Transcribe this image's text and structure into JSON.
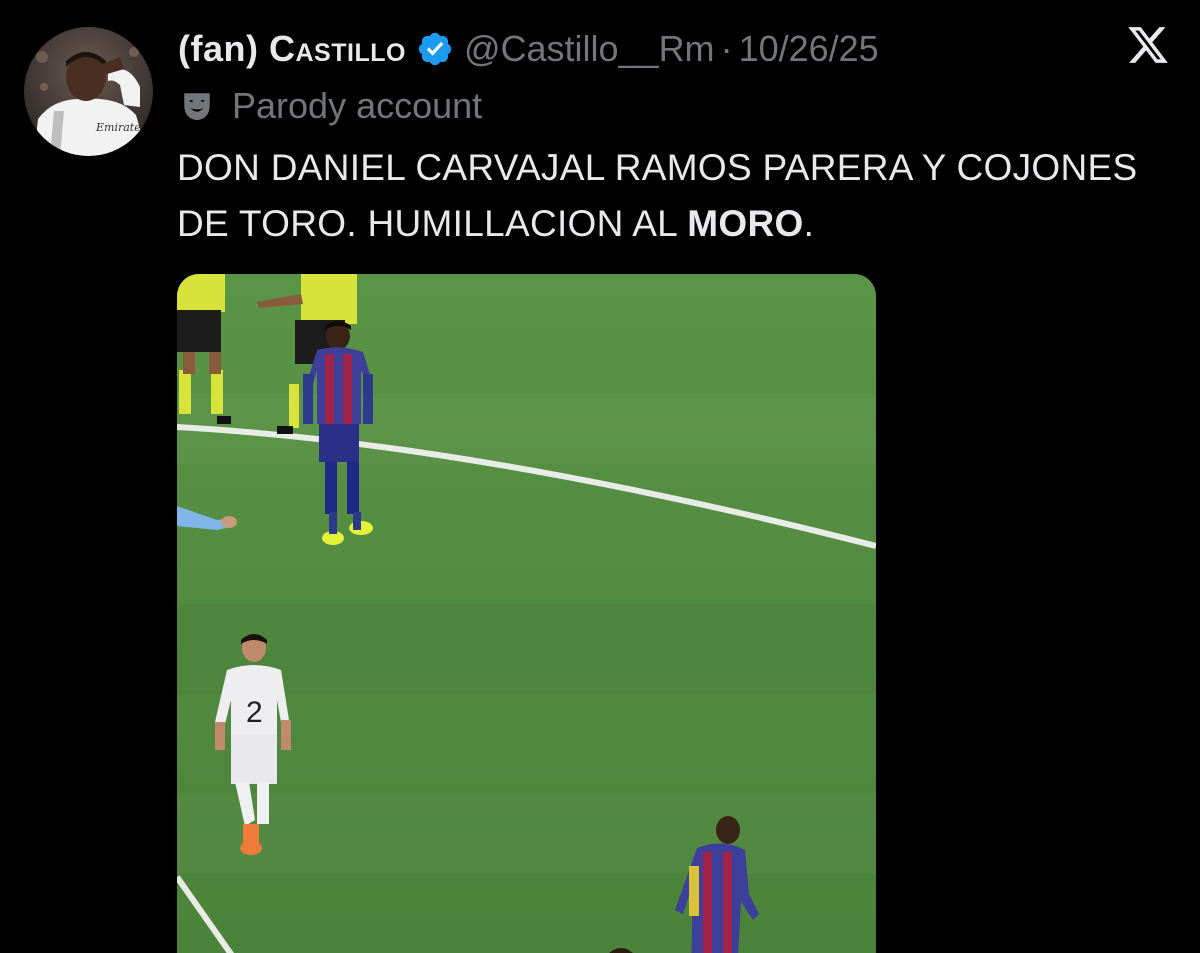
{
  "author": {
    "prefix": "(fan)",
    "name": "Castillo",
    "handle": "@Castillo__Rm",
    "separator": "·",
    "date": "10/26/25",
    "label": "Parody account",
    "verified_icon": "verified-badge-icon",
    "label_icon": "theater-mask-icon",
    "avatar": "profile-avatar"
  },
  "tweet": {
    "text_plain": "DON DANIEL CARVAJAL RAMOS PARERA Y COJONES DE TORO. HUMILLACION AL ",
    "text_bold": "MORO",
    "text_end": "."
  },
  "media": {
    "type": "video-still",
    "player_number": "2",
    "kit_sponsor": "Emirates"
  },
  "platform": {
    "logo": "x-logo-icon"
  },
  "colors": {
    "background": "#000000",
    "text": "#e7e9ea",
    "secondary": "#71767b",
    "verified": "#1d9bf0",
    "pitch": "#4f8a3f"
  }
}
